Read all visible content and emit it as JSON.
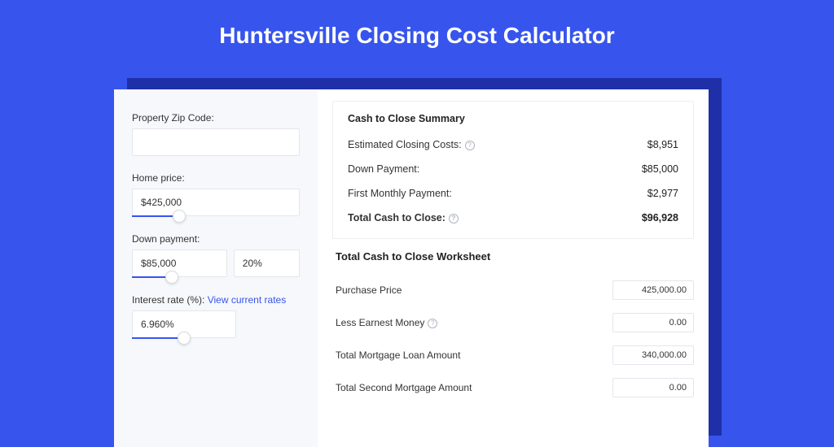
{
  "header": {
    "title": "Huntersville Closing Cost Calculator"
  },
  "left": {
    "zip_label": "Property Zip Code:",
    "zip_value": "",
    "home_price_label": "Home price:",
    "home_price_value": "$425,000",
    "home_price_slider_pct": 28,
    "down_payment_label": "Down payment:",
    "down_payment_value": "$85,000",
    "down_payment_pct_value": "20%",
    "down_payment_slider_pct": 38,
    "rate_label": "Interest rate (%):",
    "rate_link": "View current rates",
    "rate_value": "6.960%",
    "rate_slider_pct": 50
  },
  "summary": {
    "title": "Cash to Close Summary",
    "rows": [
      {
        "label": "Estimated Closing Costs:",
        "help": true,
        "value": "$8,951",
        "bold": false
      },
      {
        "label": "Down Payment:",
        "help": false,
        "value": "$85,000",
        "bold": false
      },
      {
        "label": "First Monthly Payment:",
        "help": false,
        "value": "$2,977",
        "bold": false
      },
      {
        "label": "Total Cash to Close:",
        "help": true,
        "value": "$96,928",
        "bold": true
      }
    ]
  },
  "worksheet": {
    "title": "Total Cash to Close Worksheet",
    "rows": [
      {
        "label": "Purchase Price",
        "help": false,
        "value": "425,000.00"
      },
      {
        "label": "Less Earnest Money",
        "help": true,
        "value": "0.00"
      },
      {
        "label": "Total Mortgage Loan Amount",
        "help": false,
        "value": "340,000.00"
      },
      {
        "label": "Total Second Mortgage Amount",
        "help": false,
        "value": "0.00"
      }
    ]
  }
}
